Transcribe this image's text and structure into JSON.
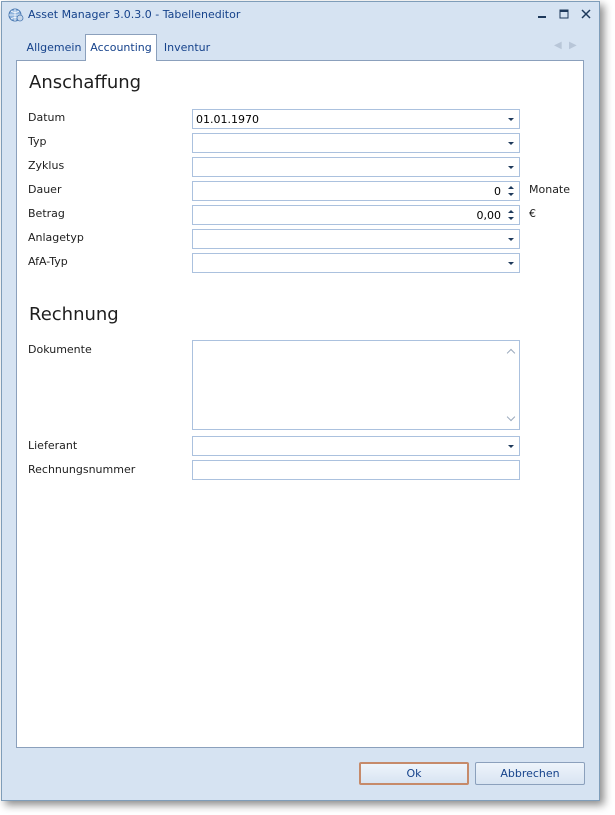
{
  "window": {
    "title": "Asset Manager 3.0.3.0 - Tabelleneditor"
  },
  "tabs": [
    {
      "label": "Allgemein"
    },
    {
      "label": "Accounting"
    },
    {
      "label": "Inventur"
    }
  ],
  "sections": {
    "anschaffung": {
      "title": "Anschaffung",
      "fields": {
        "datum": {
          "label": "Datum",
          "value": "01.01.1970"
        },
        "typ": {
          "label": "Typ",
          "value": ""
        },
        "zyklus": {
          "label": "Zyklus",
          "value": ""
        },
        "dauer": {
          "label": "Dauer",
          "value": "0",
          "unit": "Monate"
        },
        "betrag": {
          "label": "Betrag",
          "value": "0,00",
          "unit": "€"
        },
        "anlagetyp": {
          "label": "Anlagetyp",
          "value": ""
        },
        "afa_typ": {
          "label": "AfA-Typ",
          "value": ""
        }
      }
    },
    "rechnung": {
      "title": "Rechnung",
      "fields": {
        "dokumente": {
          "label": "Dokumente",
          "value": ""
        },
        "lieferant": {
          "label": "Lieferant",
          "value": ""
        },
        "rechnungsnummer": {
          "label": "Rechnungsnummer",
          "value": ""
        }
      }
    }
  },
  "buttons": {
    "ok": "Ok",
    "cancel": "Abbrechen"
  }
}
